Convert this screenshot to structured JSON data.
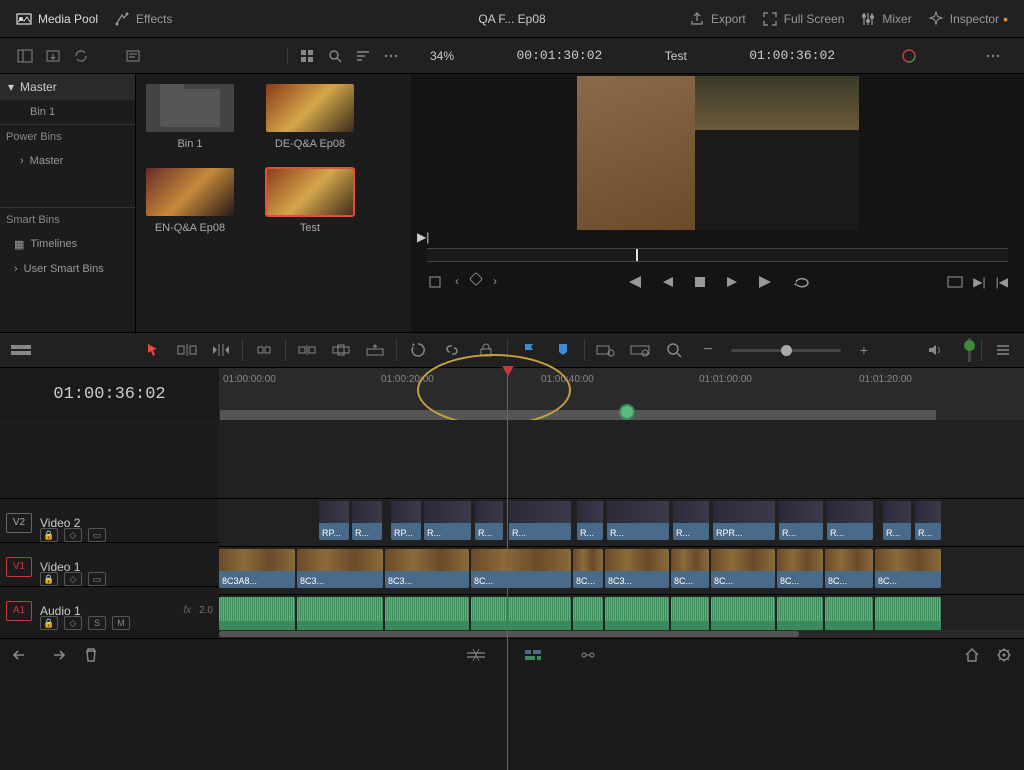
{
  "topbar": {
    "media_pool": "Media Pool",
    "effects": "Effects",
    "project_title": "QA F... Ep08",
    "export": "Export",
    "full_screen": "Full Screen",
    "mixer": "Mixer",
    "inspector": "Inspector"
  },
  "secondbar": {
    "zoom_pct": "34%",
    "source_tc": "00:01:30:02",
    "record_name": "Test",
    "record_tc": "01:00:36:02"
  },
  "sidebar": {
    "master": "Master",
    "bin1": "Bin 1",
    "power_bins": "Power Bins",
    "pb_master": "Master",
    "smart_bins": "Smart Bins",
    "timelines": "Timelines",
    "user_smart_bins": "User Smart Bins"
  },
  "clips": {
    "bin1": "Bin 1",
    "de": "DE-Q&A Ep08",
    "en": "EN-Q&A Ep08",
    "test": "Test"
  },
  "timeline": {
    "head_tc": "01:00:36:02",
    "ticks": [
      "01:00:00:00",
      "01:00:20:00",
      "01:00:40:00",
      "01:01:00:00",
      "01:01:20:00"
    ],
    "tracks": {
      "v2": {
        "tag": "V2",
        "name": "Video 2"
      },
      "v1": {
        "tag": "V1",
        "name": "Video 1"
      },
      "a1": {
        "tag": "A1",
        "name": "Audio 1",
        "fx": "fx",
        "gain": "2.0"
      }
    },
    "cliplabels": {
      "rp": "RP...",
      "r": "R...",
      "rpr": "RPR...",
      "c8": "8C3A8...",
      "c8s": "8C...",
      "c8m": "8C3..."
    },
    "mini": {
      "s": "S",
      "m": "M"
    }
  }
}
